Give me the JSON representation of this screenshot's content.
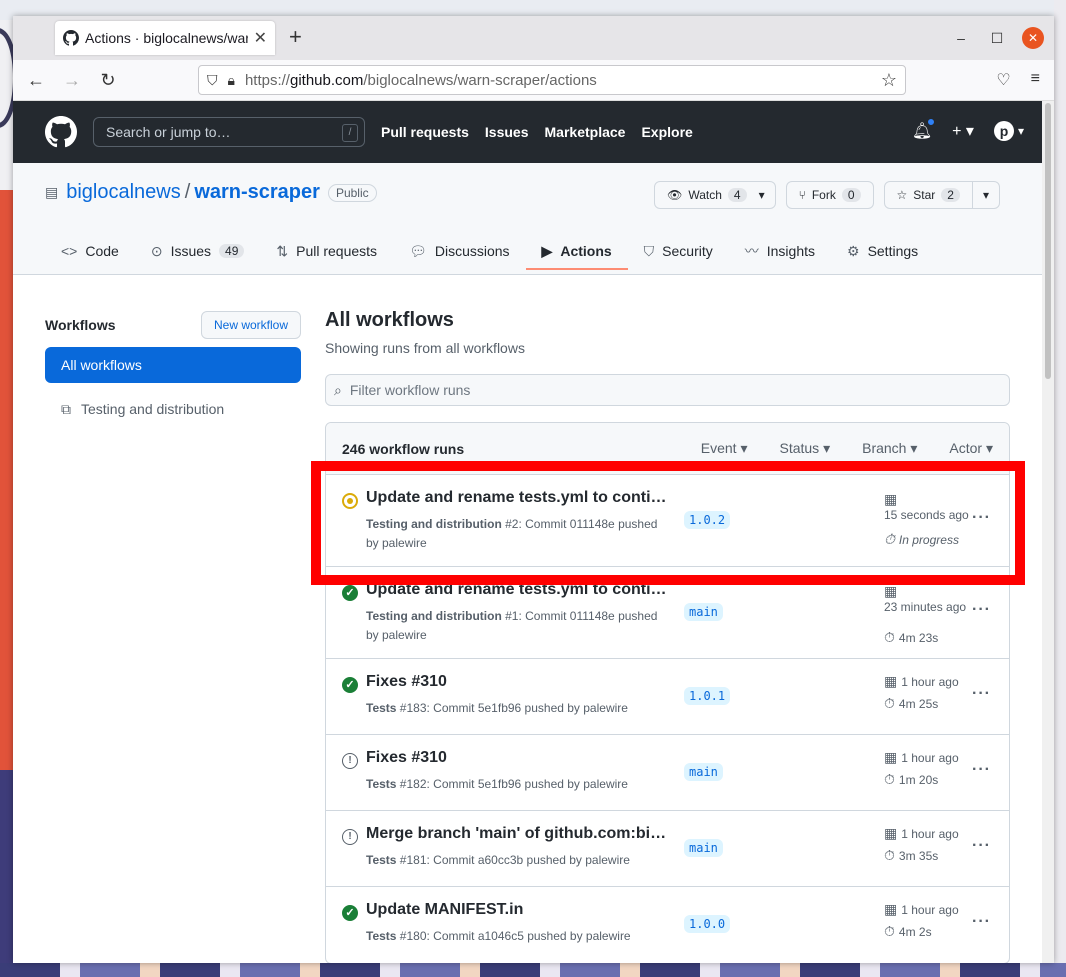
{
  "browser": {
    "tab_title": "Actions · biglocalnews/warn-scraper/actions",
    "url_prefix": "https://",
    "url_host": "github.com",
    "url_path": "/biglocalnews/warn-scraper/actions"
  },
  "gh": {
    "search_placeholder": "Search or jump to…",
    "slash_key": "/",
    "nav": [
      "Pull requests",
      "Issues",
      "Marketplace",
      "Explore"
    ],
    "avatar_letter": "p"
  },
  "repo": {
    "owner": "biglocalnews",
    "name": "warn-scraper",
    "visibility": "Public",
    "watch_label": "Watch",
    "watch_count": "4",
    "fork_label": "Fork",
    "fork_count": "0",
    "star_label": "Star",
    "star_count": "2",
    "tabs": [
      {
        "label": "Code",
        "icon": "code-icon"
      },
      {
        "label": "Issues",
        "icon": "issues-icon",
        "count": "49"
      },
      {
        "label": "Pull requests",
        "icon": "pull-request-icon"
      },
      {
        "label": "Discussions",
        "icon": "discussions-icon"
      },
      {
        "label": "Actions",
        "icon": "actions-icon"
      },
      {
        "label": "Security",
        "icon": "security-icon"
      },
      {
        "label": "Insights",
        "icon": "insights-icon"
      },
      {
        "label": "Settings",
        "icon": "settings-icon"
      }
    ]
  },
  "sidebar": {
    "heading": "Workflows",
    "new_workflow": "New workflow",
    "items": [
      {
        "label": "All workflows"
      },
      {
        "label": "Testing and distribution"
      }
    ]
  },
  "main": {
    "title": "All workflows",
    "subtitle": "Showing runs from all workflows",
    "filter_placeholder": "Filter workflow runs",
    "run_count": "246 workflow runs",
    "filters": [
      "Event",
      "Status",
      "Branch",
      "Actor"
    ],
    "runs": [
      {
        "title": "Update and rename tests.yml to conti…",
        "workflow": "Testing and distribution",
        "meta": " #2: Commit 011148e pushed by palewire",
        "branch": "1.0.2",
        "when": "15 seconds ago",
        "duration": "In progress",
        "status": "in-progress"
      },
      {
        "title": "Update and rename tests.yml to conti…",
        "workflow": "Testing and distribution",
        "meta": " #1: Commit 011148e pushed by palewire",
        "branch": "main",
        "when": "23 minutes ago",
        "duration": "4m 23s",
        "status": "success"
      },
      {
        "title": "Fixes #310",
        "workflow": "Tests",
        "meta": " #183: Commit 5e1fb96 pushed by palewire",
        "branch": "1.0.1",
        "when": "1 hour ago",
        "duration": "4m 25s",
        "status": "success"
      },
      {
        "title": "Fixes #310",
        "workflow": "Tests",
        "meta": " #182: Commit 5e1fb96 pushed by palewire",
        "branch": "main",
        "when": "1 hour ago",
        "duration": "1m 20s",
        "status": "neutral"
      },
      {
        "title": "Merge branch 'main' of github.com:bi…",
        "workflow": "Tests",
        "meta": " #181: Commit a60cc3b pushed by palewire",
        "branch": "main",
        "when": "1 hour ago",
        "duration": "3m 35s",
        "status": "neutral"
      },
      {
        "title": "Update MANIFEST.in",
        "workflow": "Tests",
        "meta": " #180: Commit a1046c5 pushed by palewire",
        "branch": "1.0.0",
        "when": "1 hour ago",
        "duration": "4m 2s",
        "status": "success"
      }
    ]
  },
  "colors": {
    "accent": "#0969da",
    "header_bg": "#24292f",
    "highlight": "#ff0000",
    "success": "#1a7f37",
    "in_progress": "#dbab09"
  }
}
